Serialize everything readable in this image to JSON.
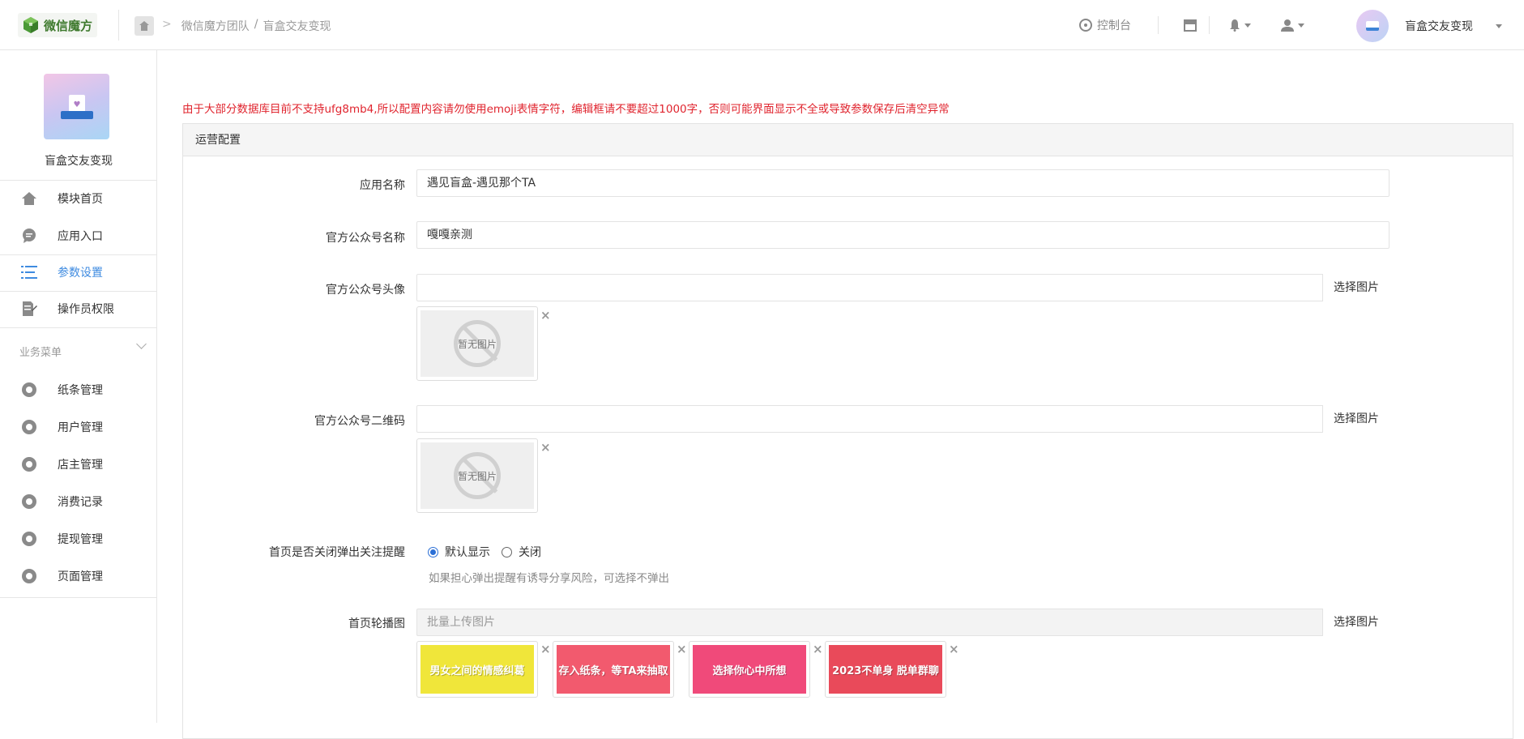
{
  "header": {
    "logo_text": "微信魔方",
    "breadcrumb": [
      "微信魔方团队",
      "/",
      "盲盒交友变现"
    ],
    "console_label": "控制台",
    "user_name": "盲盒交友变现"
  },
  "sidebar": {
    "app_name": "盲盒交友变现",
    "items": [
      {
        "label": "模块首页"
      },
      {
        "label": "应用入口"
      },
      {
        "label": "参数设置"
      },
      {
        "label": "操作员权限"
      }
    ],
    "section_title": "业务菜单",
    "business_items": [
      {
        "label": "纸条管理"
      },
      {
        "label": "用户管理"
      },
      {
        "label": "店主管理"
      },
      {
        "label": "消费记录"
      },
      {
        "label": "提现管理"
      },
      {
        "label": "页面管理"
      }
    ]
  },
  "main": {
    "notice": "由于大部分数据库目前不支持ufg8mb4,所以配置内容请勿使用emoji表情字符，编辑框请不要超过1000字，否则可能界面显示不全或导致参数保存后清空异常",
    "panel_title": "运营配置",
    "app_name_label": "应用名称",
    "app_name_value": "遇见盲盒-遇见那个TA",
    "official_name_label": "官方公众号名称",
    "official_name_value": "嘎嘎亲测",
    "official_avatar_label": "官方公众号头像",
    "official_qr_label": "官方公众号二维码",
    "select_image": "选择图片",
    "no_image": "暂无图片",
    "popup_label": "首页是否关闭弹出关注提醒",
    "radio_default": "默认显示",
    "radio_close": "关闭",
    "popup_help": "如果担心弹出提醒有诱导分享风险，可选择不弹出",
    "carousel_label": "首页轮播图",
    "carousel_placeholder": "批量上传图片",
    "carousel_images": [
      {
        "caption": "男女之间的情感纠葛",
        "color": "#f0e63a"
      },
      {
        "caption": "存入纸条，等TA来抽取",
        "color": "#f25a6e"
      },
      {
        "caption": "选择你心中所想",
        "color": "#f04a7a"
      },
      {
        "caption": "2023不单身 脱单群聊",
        "color": "#e94a5a"
      }
    ],
    "delete_mark": "×"
  }
}
